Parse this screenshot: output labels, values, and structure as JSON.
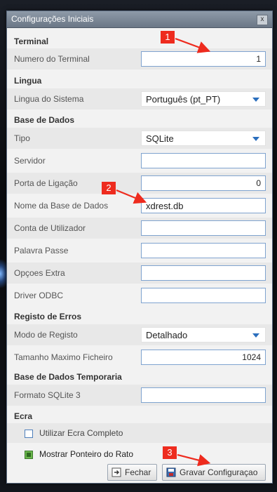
{
  "window": {
    "title": "Configurações Iniciais",
    "close_label": "x"
  },
  "sections": {
    "terminal": "Terminal",
    "lingua": "Lingua",
    "base_dados": "Base de Dados",
    "registo_erros": "Registo de Erros",
    "base_dados_temp": "Base de Dados Temporaria",
    "ecra": "Ecra"
  },
  "fields": {
    "numero_terminal": {
      "label": "Numero do Terminal",
      "value": "1"
    },
    "lingua_sistema": {
      "label": "Lingua do Sistema",
      "value": "Português (pt_PT)"
    },
    "tipo": {
      "label": "Tipo",
      "value": "SQLite"
    },
    "servidor": {
      "label": "Servidor",
      "value": ""
    },
    "porta": {
      "label": "Porta de Ligação",
      "value": "0"
    },
    "nome_bd": {
      "label": "Nome da Base de Dados",
      "value": "xdrest.db"
    },
    "conta": {
      "label": "Conta de Utilizador",
      "value": ""
    },
    "palavra_passe": {
      "label": "Palavra Passe",
      "value": ""
    },
    "opcoes_extra": {
      "label": "Opçoes Extra",
      "value": ""
    },
    "driver_odbc": {
      "label": "Driver ODBC",
      "value": ""
    },
    "modo_registo": {
      "label": "Modo de Registo",
      "value": "Detalhado"
    },
    "tamanho_max": {
      "label": "Tamanho Maximo Ficheiro",
      "value": "1024"
    },
    "formato_sqlite": {
      "label": "Formato SQLite 3",
      "value": ""
    }
  },
  "checkboxes": {
    "ecra_completo": {
      "label": "Utilizar Ecra Completo",
      "checked": false
    },
    "ponteiro_rato": {
      "label": "Mostrar Ponteiro do Rato",
      "checked": true
    }
  },
  "buttons": {
    "fechar": "Fechar",
    "gravar": "Gravar Configuraçao"
  },
  "annotations": [
    "1",
    "2",
    "3"
  ],
  "colors": {
    "annotation": "#ee2b1e",
    "dropdown_arrow": "#2a6ebd",
    "title_bar": "#7a8595"
  }
}
